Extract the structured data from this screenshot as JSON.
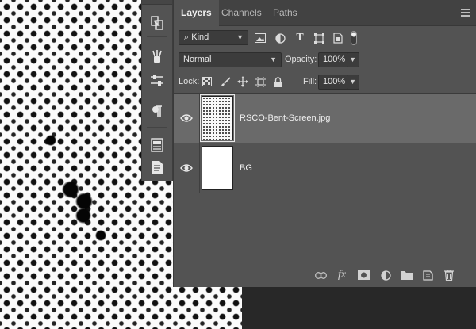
{
  "panel": {
    "tabs": [
      "Layers",
      "Channels",
      "Paths"
    ],
    "filter": {
      "label": "Kind"
    },
    "blend_mode": "Normal",
    "opacity": {
      "label": "Opacity:",
      "value": "100%"
    },
    "lock": {
      "label": "Lock:"
    },
    "fill": {
      "label": "Fill:",
      "value": "100%"
    }
  },
  "layers": [
    {
      "name": "RSCO-Bent-Screen.jpg",
      "selected": true,
      "visible": true
    },
    {
      "name": "BG",
      "selected": false,
      "visible": true
    }
  ],
  "tool_strip": {
    "icons": [
      "swap-panels-icon",
      "brush-presets-icon",
      "adjust-sliders-icon",
      "paragraph-icon",
      "character-style-icon",
      "notes-icon"
    ]
  },
  "bottom_bar": {
    "icons": [
      "link-layers-icon",
      "fx-icon",
      "add-mask-icon",
      "adjustment-layer-icon",
      "group-folder-icon",
      "new-layer-icon",
      "delete-layer-icon"
    ],
    "fx_label": "fx"
  },
  "colors": {
    "panel_bg": "#535353",
    "selected_row": "#6a6a6a",
    "tab_bar": "#424242",
    "field_bg": "#3c3c3c"
  }
}
